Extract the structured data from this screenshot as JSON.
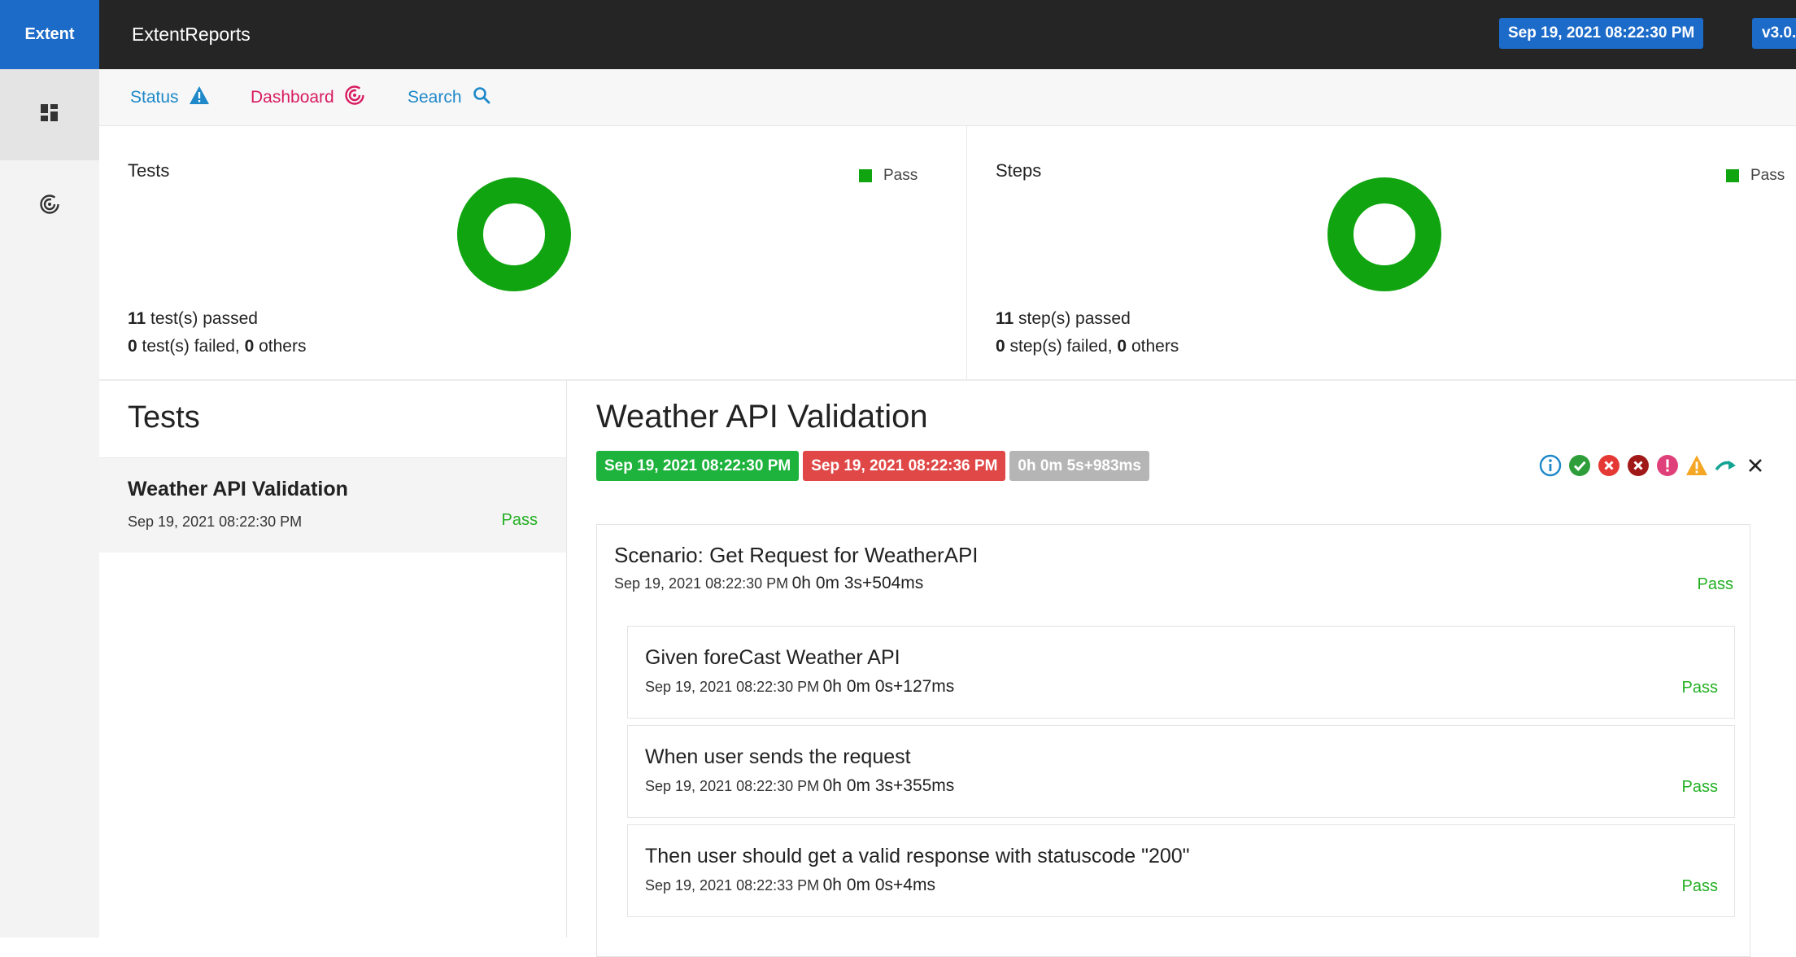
{
  "header": {
    "brand": "Extent",
    "app_title": "ExtentReports",
    "report_date": "Sep 19, 2021 08:22:30 PM",
    "version": "v3.0."
  },
  "sidenav": {
    "items": [
      {
        "icon": "dashboard-grid-icon",
        "active": true
      },
      {
        "icon": "target-icon",
        "active": false
      }
    ]
  },
  "subnav": {
    "items": [
      {
        "label": "Status",
        "icon": "warning-triangle-icon",
        "color": "#1e88c9"
      },
      {
        "label": "Dashboard",
        "icon": "target-icon",
        "color": "#d81b60"
      },
      {
        "label": "Search",
        "icon": "search-icon",
        "color": "#1e88c9"
      }
    ]
  },
  "colors": {
    "pass": "#10a510",
    "brand": "#1c6bc9",
    "fail": "#e04848",
    "duration": "#b5b5b5"
  },
  "summary": {
    "tests": {
      "title": "Tests",
      "legend": "Pass",
      "passed_count": "11",
      "passed_text": " test(s) passed",
      "failed_count": "0",
      "failed_text": " test(s) failed, ",
      "others_count": "0",
      "others_text": " others",
      "pass_fraction": 1.0
    },
    "steps": {
      "title": "Steps",
      "legend": "Pass",
      "passed_count": "11",
      "passed_text": " step(s) passed",
      "failed_count": "0",
      "failed_text": " step(s) failed, ",
      "others_count": "0",
      "others_text": " others",
      "pass_fraction": 1.0
    }
  },
  "tests_list": {
    "heading": "Tests",
    "items": [
      {
        "name": "Weather API Validation",
        "time": "Sep 19, 2021 08:22:30 PM",
        "status": "Pass"
      }
    ]
  },
  "detail": {
    "title": "Weather API Validation",
    "start_time": "Sep 19, 2021 08:22:30 PM",
    "end_time": "Sep 19, 2021 08:22:36 PM",
    "duration": "0h 0m 5s+983ms",
    "filters": [
      "info-icon",
      "pass-icon",
      "fail-icon",
      "fatal-icon",
      "error-icon",
      "warning-icon",
      "skip-icon",
      "clear-icon"
    ],
    "scenario": {
      "name": "Scenario: Get Request for WeatherAPI",
      "time": "Sep 19, 2021 08:22:30 PM",
      "duration": "0h 0m 3s+504ms",
      "status": "Pass",
      "steps": [
        {
          "name": "Given foreCast Weather API",
          "time": "Sep 19, 2021 08:22:30 PM",
          "duration": "0h 0m 0s+127ms",
          "status": "Pass"
        },
        {
          "name": "When user sends the request",
          "time": "Sep 19, 2021 08:22:30 PM",
          "duration": "0h 0m 3s+355ms",
          "status": "Pass"
        },
        {
          "name": "Then user should get a valid response with statuscode \"200\"",
          "time": "Sep 19, 2021 08:22:33 PM",
          "duration": "0h 0m 0s+4ms",
          "status": "Pass"
        }
      ]
    }
  }
}
